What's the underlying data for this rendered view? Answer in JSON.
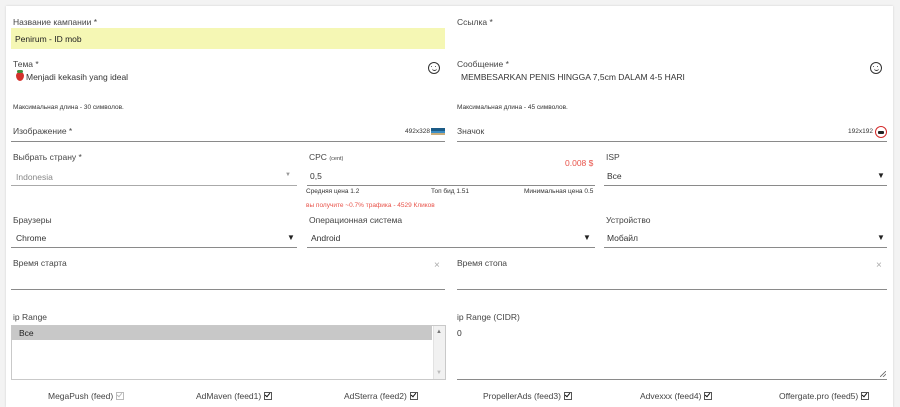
{
  "campaign": {
    "label": "Название кампании *",
    "value": "Penirum - ID mob"
  },
  "link": {
    "label": "Ссылка *",
    "value": ""
  },
  "topic": {
    "label": "Тема *",
    "value": "Menjadi kekasih yang ideal",
    "hint": "Максимальная длина - 30 символов."
  },
  "message": {
    "label": "Сообщение *",
    "value": "MEMBESARKAN PENIS HINGGA 7,5cm DALAM 4-5 HARI",
    "hint": "Максимальная длина - 45 символов."
  },
  "image": {
    "label": "Изображение *",
    "size": "492x328"
  },
  "icon": {
    "label": "Значок",
    "size": "192x192"
  },
  "country": {
    "label": "Выбрать страну *",
    "value": "Indonesia"
  },
  "cpc": {
    "label": "CPC",
    "unit": "(cent)",
    "value": "0,5",
    "price": "0.008 $",
    "avg": "Средняя цена 1.2",
    "top_bid": "Топ бид 1.51",
    "min_price": "Минимальная цена 0.5",
    "estimate": "вы получите ~0.7% трафика - 4529 Кликов"
  },
  "isp": {
    "label": "ISP",
    "value": "Все"
  },
  "browsers": {
    "label": "Браузеры",
    "value": "Chrome"
  },
  "os": {
    "label": "Операционная система",
    "value": "Android"
  },
  "device": {
    "label": "Устройство",
    "value": "Мобайл"
  },
  "start_time": {
    "label": "Время старта",
    "value": ""
  },
  "stop_time": {
    "label": "Время стопа",
    "value": ""
  },
  "ip_range": {
    "label": "ip Range",
    "options": [
      "Все"
    ],
    "selected": "Все"
  },
  "ip_cidr": {
    "label": "ip Range (CIDR)",
    "value": "0"
  },
  "feeds": [
    {
      "label": "MegaPush (feed)",
      "checked": false
    },
    {
      "label": "AdMaven (feed1)",
      "checked": true
    },
    {
      "label": "AdSterra (feed2)",
      "checked": true
    },
    {
      "label": "PropellerAds (feed3)",
      "checked": true
    },
    {
      "label": "Advexxx (feed4)",
      "checked": true
    },
    {
      "label": "Offergate.pro (feed5)",
      "checked": true
    }
  ],
  "icons": {
    "dropdown": "triangle-down",
    "clear": "times",
    "emoji": "smiley-face",
    "topic_emoji": "strawberry"
  },
  "colors": {
    "highlight": "#f5f7b4",
    "warning": "#e8534a"
  }
}
